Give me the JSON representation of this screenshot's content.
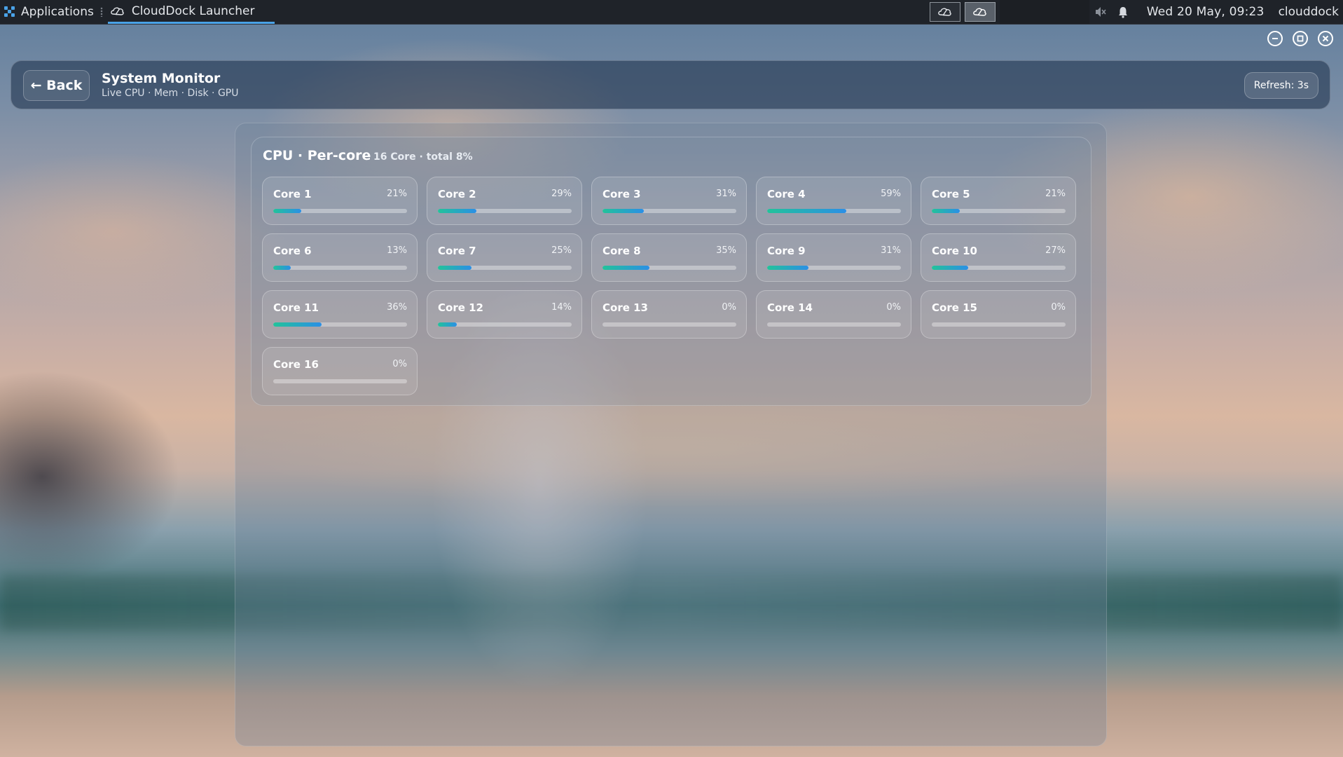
{
  "taskbar": {
    "apps_label": "Applications",
    "task_title": "CloudDock Launcher",
    "clock": "Wed 20 May, 09:23",
    "user": "clouddock"
  },
  "header": {
    "back_label": "← Back",
    "title": "System Monitor",
    "subtitle": "Live CPU · Mem · Disk · GPU",
    "refresh_label": "Refresh: 3s"
  },
  "cpu": {
    "title": "CPU · Per-core",
    "summary": "16 Core · total 8%",
    "cores": [
      {
        "name": "Core 1",
        "percent_label": "21%",
        "value": 21
      },
      {
        "name": "Core 2",
        "percent_label": "29%",
        "value": 29
      },
      {
        "name": "Core 3",
        "percent_label": "31%",
        "value": 31
      },
      {
        "name": "Core 4",
        "percent_label": "59%",
        "value": 59
      },
      {
        "name": "Core 5",
        "percent_label": "21%",
        "value": 21
      },
      {
        "name": "Core 6",
        "percent_label": "13%",
        "value": 13
      },
      {
        "name": "Core 7",
        "percent_label": "25%",
        "value": 25
      },
      {
        "name": "Core 8",
        "percent_label": "35%",
        "value": 35
      },
      {
        "name": "Core 9",
        "percent_label": "31%",
        "value": 31
      },
      {
        "name": "Core 10",
        "percent_label": "27%",
        "value": 27
      },
      {
        "name": "Core 11",
        "percent_label": "36%",
        "value": 36
      },
      {
        "name": "Core 12",
        "percent_label": "14%",
        "value": 14
      },
      {
        "name": "Core 13",
        "percent_label": "0%",
        "value": 0
      },
      {
        "name": "Core 14",
        "percent_label": "0%",
        "value": 0
      },
      {
        "name": "Core 15",
        "percent_label": "0%",
        "value": 0
      },
      {
        "name": "Core 16",
        "percent_label": "0%",
        "value": 0
      }
    ]
  },
  "colors": {
    "bar_start": "#22c39a",
    "bar_end": "#2b8fe6",
    "task_underline": "#4aa3e8"
  }
}
